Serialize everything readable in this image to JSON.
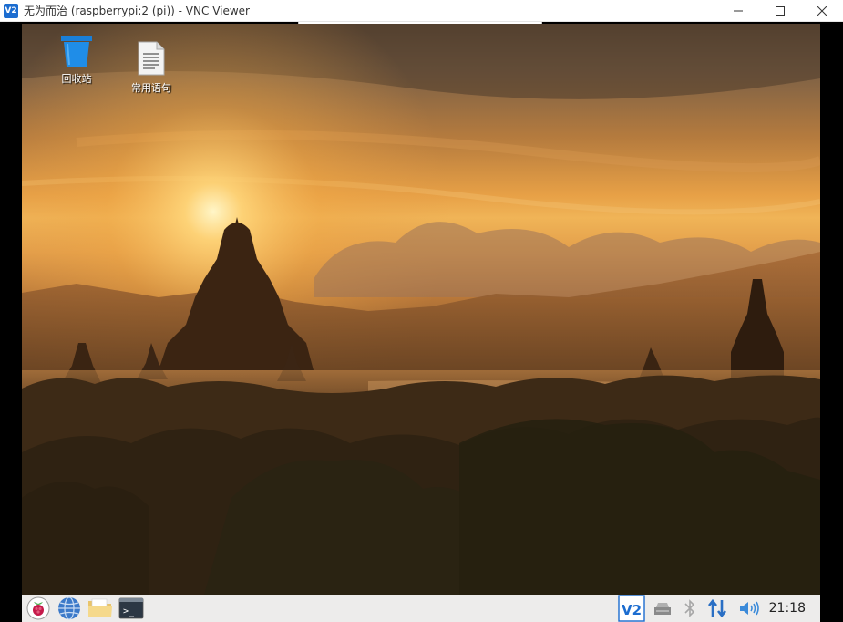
{
  "window": {
    "icon_label": "V2",
    "title": "无为而治 (raspberrypi:2 (pi)) - VNC Viewer"
  },
  "desktop": {
    "wallpaper": "sunset-temples",
    "icons": [
      {
        "label": "回收站",
        "icon": "trash-icon"
      },
      {
        "label": "常用语句",
        "icon": "text-file-icon"
      }
    ]
  },
  "taskbar": {
    "launchers": [
      "raspberry-menu-icon",
      "web-browser-icon",
      "file-manager-icon",
      "terminal-icon"
    ],
    "tray": [
      "vnc-server-icon",
      "eject-icon",
      "bluetooth-icon",
      "network-icon",
      "volume-icon"
    ],
    "tray_vnc_label": "V2",
    "terminal_glyph": ">_",
    "clock": "21:18"
  },
  "colors": {
    "taskbar_bg": "#edeceb",
    "vnc_blue": "#1c6dd0",
    "network_blue": "#2a6fc4"
  }
}
